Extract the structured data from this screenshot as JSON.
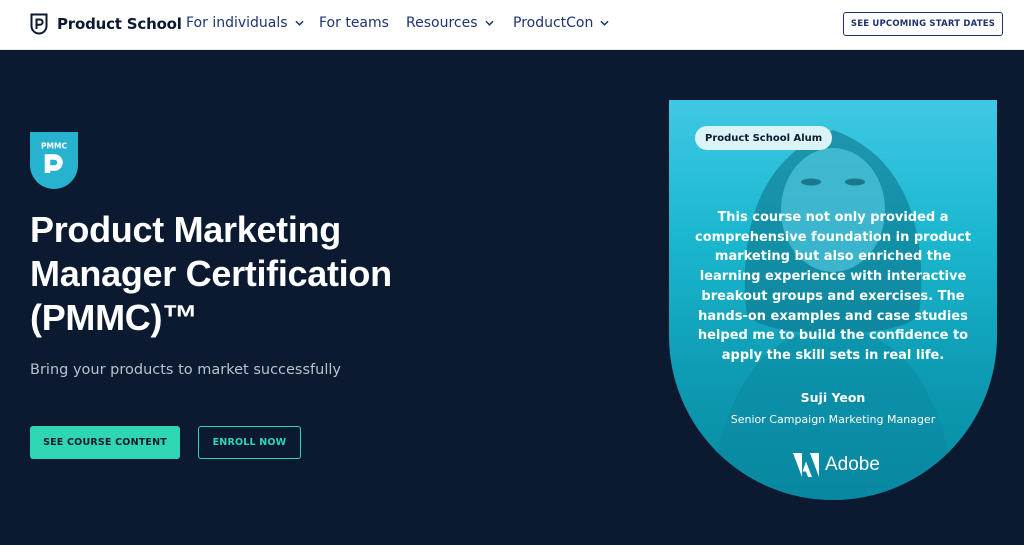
{
  "nav": {
    "brand": "Product School",
    "items": [
      {
        "label": "For individuals",
        "has_dropdown": true
      },
      {
        "label": "For teams",
        "has_dropdown": false
      },
      {
        "label": "Resources",
        "has_dropdown": true
      },
      {
        "label": "ProductCon",
        "has_dropdown": true
      }
    ],
    "cta": "SEE UPCOMING START DATES"
  },
  "hero": {
    "badge_text": "PMMC",
    "title": "Product Marketing Manager Certification (PMMC)™",
    "subtitle": "Bring your products to market successfully",
    "primary_button": "SEE COURSE CONTENT",
    "secondary_button": "ENROLL NOW"
  },
  "testimonial": {
    "tag": "Product School Alum",
    "quote": "This course not only provided a comprehensive foundation in product marketing but also enriched the learning experience with interactive breakout groups and exercises. The hands-on examples and case studies helped me to build the confidence to apply the skill sets in real life.",
    "author": "Suji Yeon",
    "role": "Senior Campaign Marketing Manager",
    "company": "Adobe"
  },
  "colors": {
    "background": "#0b1a30",
    "accent": "#2ed6b3",
    "nav_text": "#1d3470",
    "badge": "#27b3cf",
    "card_gradient_top": "#3fc8e4",
    "card_gradient_bottom": "#078ba1"
  },
  "icons": [
    "product-school-logo-icon",
    "chevron-down-icon",
    "pmmc-badge-icon",
    "adobe-logo-icon"
  ]
}
